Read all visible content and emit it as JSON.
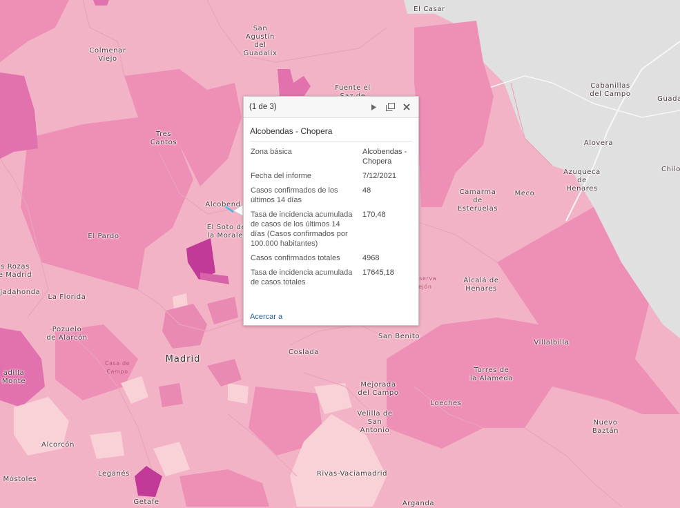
{
  "colors": {
    "outside": "#d9d9d9",
    "base": "#f2b3c6",
    "medium": "#ee95b8",
    "strong": "#e477a8",
    "dark": "#d05aa0",
    "darkest": "#c43a98",
    "light": "#f7cfd5"
  },
  "places": {
    "el_casar": "El Casar",
    "san_agustin": "San\nAgustín\ndel\nGuadalix",
    "colmenar": "Colmenar\nViejo",
    "fuente_saz": "Fuente el\nSaz de",
    "cabanillas": "Cabanillas\ndel Campo",
    "guada": "Guada",
    "tres_cantos": "Tres\nCantos",
    "alovera": "Alovera",
    "azuqueca": "Azuqueca\nde\nHenares",
    "chilo": "Chilo",
    "alcobendas": "Alcobend",
    "camarma": "Camarma\nde\nEsteruelas",
    "meco": "Meco",
    "el_soto": "El Soto de\nla Moralej",
    "el_pardo": "El Pardo",
    "las_rozas": "s Rozas\ne Madrid",
    "majadahonda": "ajadahonda",
    "la_florida": "La Florida",
    "alcala": "Alcalá de\nHenares",
    "pozuelo": "Pozuelo\nde Alarcón",
    "san_benito": "San Benito",
    "villalbilla": "Villalbilla",
    "madrid": "Madrid",
    "coslada": "Coslada",
    "boadilla": "adilla\nMonte",
    "casa_campo": "Casa de\nCampo",
    "torres": "Torres de\nla Alameda",
    "mejorada": "Mejorada\ndel Campo",
    "loeches": "Loeches",
    "velilla": "Velilla de\nSan\nAntonio",
    "nuevo_baztan": "Nuevo\nBaztán",
    "alcorcon": "Alcorcón",
    "leganes": "Leganés",
    "rivas": "Rivas-Vaciamadrid",
    "mostoles": "Móstoles",
    "getafe": "Getafe",
    "arganda": "Arganda",
    "reserva": "Reserva\nrejón"
  },
  "popup": {
    "counter": "(1 de 3)",
    "title": "Alcobendas - Chopera",
    "rows": [
      {
        "key": "Zona básica",
        "value": "Alcobendas - Chopera"
      },
      {
        "key": "Fecha del informe",
        "value": "7/12/2021"
      },
      {
        "key": "Casos confirmados de los últimos 14 días",
        "value": "48"
      },
      {
        "key": "Tasa de incidencia acumulada de casos de los últimos 14 días (Casos confirmados por 100.000 habitantes)",
        "value": "170,48"
      },
      {
        "key": "Casos confirmados totales",
        "value": "4968"
      },
      {
        "key": "Tasa de incidencia acumulada de casos totales",
        "value": "17645,18"
      }
    ],
    "zoom_link": "Acercar a",
    "icons": {
      "next": "play-icon",
      "dock": "dock-icon",
      "close": "close-icon"
    }
  }
}
